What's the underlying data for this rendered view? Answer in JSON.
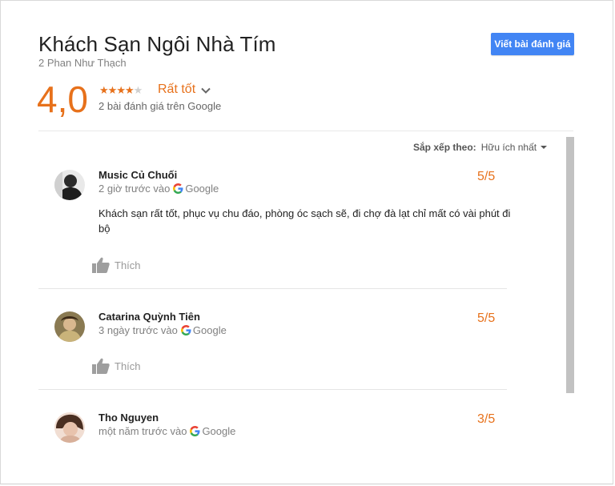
{
  "place": {
    "name": "Khách Sạn Ngôi Nhà Tím",
    "address": "2 Phan Như Thạch"
  },
  "write_review_label": "Viết bài đánh giá",
  "summary": {
    "rating": "4,0",
    "stars_filled": 4,
    "stars_total": 5,
    "rating_text": "Rất tốt",
    "review_count_text": "2 bài đánh giá trên Google"
  },
  "sort": {
    "label": "Sắp xếp theo:",
    "value": "Hữu ích nhất"
  },
  "reviews": [
    {
      "name": "Music Củ Chuối",
      "time": "2 giờ trước vào",
      "source": "Google",
      "score": "5/5",
      "text": "Khách sạn rất tốt, phục vụ chu đáo, phòng óc sạch sẽ, đi chợ đà lạt chỉ mất có vài phút đi bộ",
      "like_label": "Thích"
    },
    {
      "name": "Catarina Quỳnh Tiên",
      "time": "3 ngày trước vào",
      "source": "Google",
      "score": "5/5",
      "text": "",
      "like_label": "Thích"
    },
    {
      "name": "Tho Nguyen",
      "time": "một năm trước vào",
      "source": "Google",
      "score": "3/5",
      "text": "",
      "like_label": ""
    }
  ],
  "colors": {
    "accent": "#e7711b",
    "button": "#4285f4",
    "muted": "#808080"
  }
}
